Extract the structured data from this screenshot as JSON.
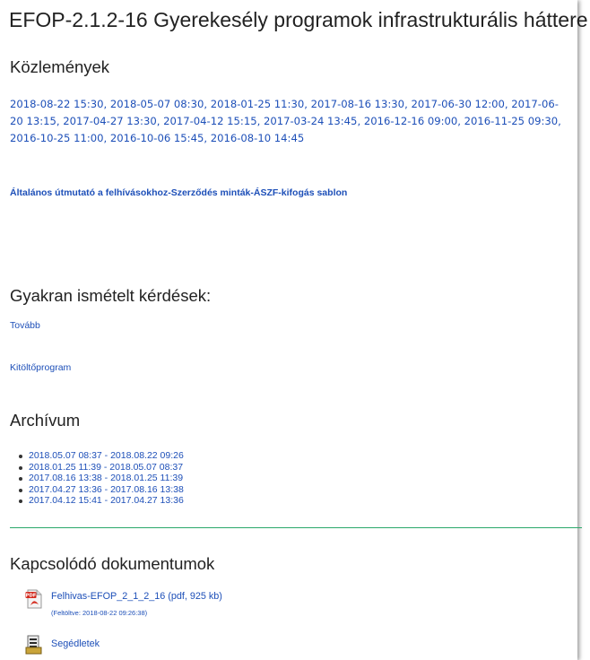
{
  "page": {
    "title": "EFOP-2.1.2-16 Gyerekesély programok infrastrukturális háttere"
  },
  "announcements": {
    "heading": "Közlemények",
    "dates": [
      "2018-08-22 15:30",
      "2018-05-07 08:30",
      "2018-01-25 11:30",
      "2017-08-16 13:30",
      "2017-06-30 12:00",
      "2017-06-20 13:15",
      "2017-04-27 13:30",
      "2017-04-12 15:15",
      "2017-03-24 13:45",
      "2016-12-16 09:00",
      "2016-11-25 09:30",
      "2016-10-25 11:00",
      "2016-10-06 15:45",
      "2016-08-10 14:45"
    ],
    "guide_link": "Általános útmutató a felhívásokhoz-Szerződés minták-ÁSZF-kifogás sablon"
  },
  "faq": {
    "heading": "Gyakran ismételt kérdések:",
    "more_link": "Tovább",
    "filler_link": "Kitöltőprogram"
  },
  "archive": {
    "heading": "Archívum",
    "items": [
      "2018.05.07 08:37 - 2018.08.22 09:26",
      "2018.01.25 11:39 - 2018.05.07 08:37",
      "2017.08.16 13:38 - 2018.01.25 11:39",
      "2017.04.27 13:36 - 2017.08.16 13:38",
      "2017.04.12 15:41 - 2017.04.27 13:36"
    ]
  },
  "documents": {
    "heading": "Kapcsolódó dokumentumok",
    "items": [
      {
        "icon": "pdf-icon",
        "name": "Felhivas-EFOP_2_1_2_16 (pdf, 925 kb)",
        "meta": "(Feltöltve: 2018-08-22 09:26:38)"
      },
      {
        "icon": "folder-document-icon",
        "name": "Segédletek"
      }
    ]
  },
  "colors": {
    "link": "#1d4fb8",
    "divider": "#2aa86a",
    "heading": "#222222"
  }
}
